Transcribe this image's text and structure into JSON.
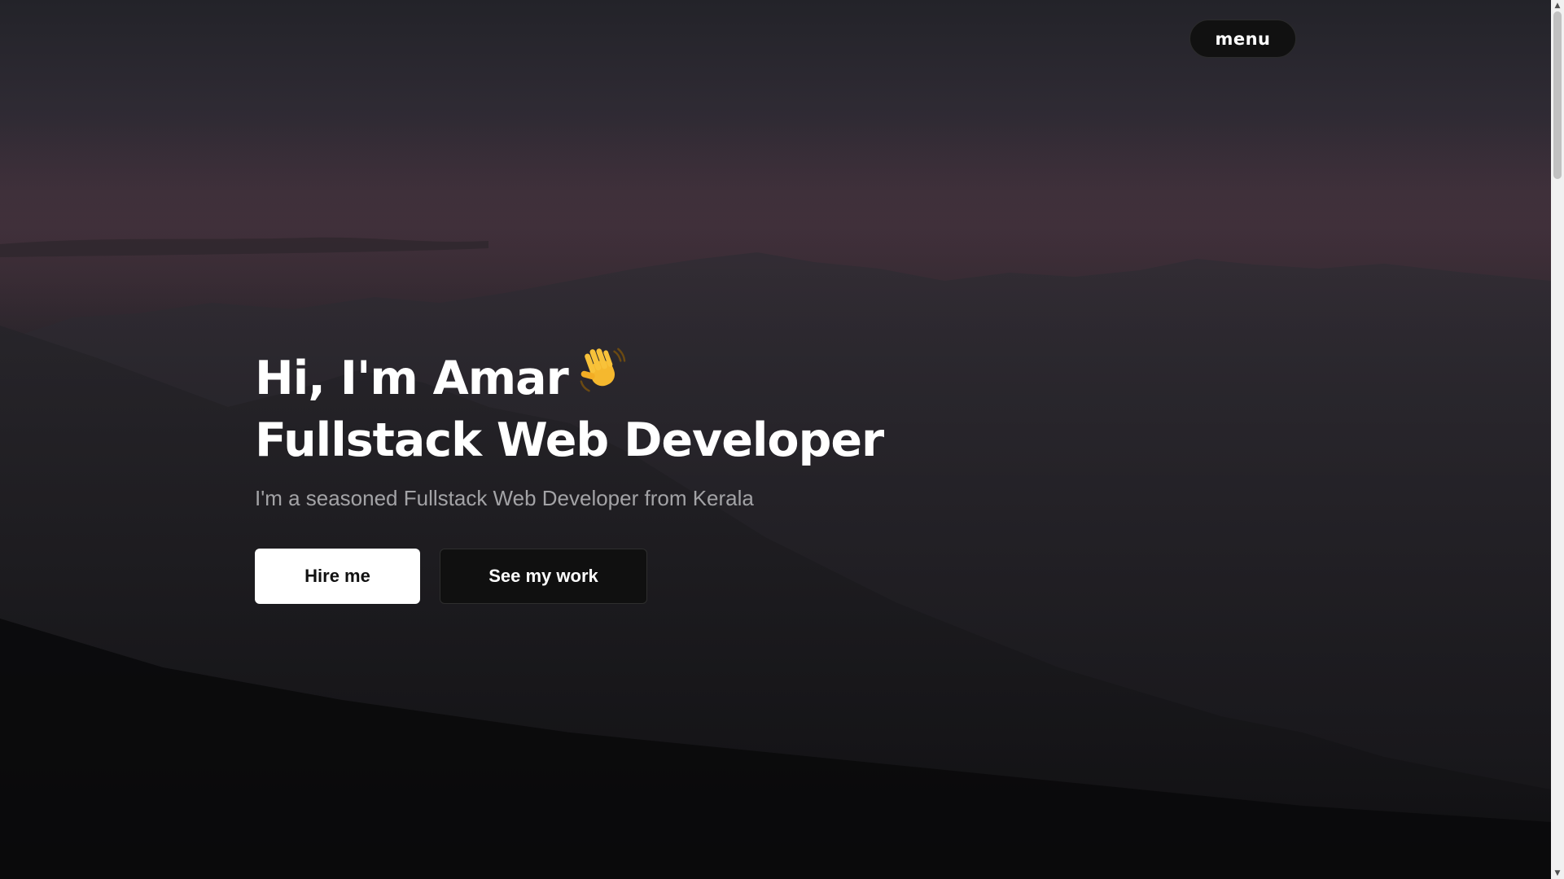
{
  "header": {
    "menu_label": "menu"
  },
  "hero": {
    "greeting": "Hi, I'm Amar",
    "greeting_icon": "waving-hand-icon",
    "role": "Fullstack Web Developer",
    "subtitle": "I'm a seasoned Fullstack Web Developer from Kerala",
    "buttons": {
      "hire_label": "Hire me",
      "work_label": "See my work"
    }
  },
  "scrollbar": {
    "up_icon": "scroll-up-arrow-icon",
    "down_icon": "scroll-down-arrow-icon"
  },
  "colors": {
    "background_top": "#232329",
    "background_bottom": "#0b0b0c",
    "primary_button": "#ffffff",
    "secondary_button": "#101010",
    "text": "#ffffff",
    "subtitle_text": "#a3a3a6"
  }
}
